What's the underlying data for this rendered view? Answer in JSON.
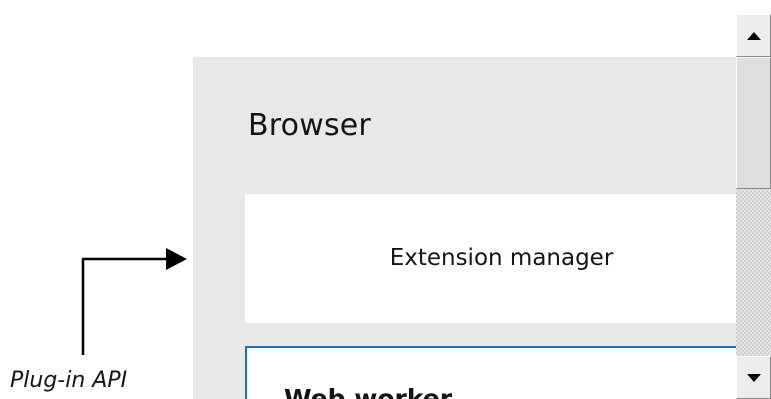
{
  "diagram": {
    "browser_title": "Browser",
    "extension_manager_label": "Extension manager",
    "web_worker_label": "Web worker",
    "plugin_api_label": "Plug-in API"
  },
  "colors": {
    "panel_background": "#e8e8e8",
    "box_background": "#ffffff",
    "worker_border": "#1e6fc0",
    "text": "#151515",
    "connector": "#000000"
  },
  "icons": {
    "scroll_up": "triangle-up-icon",
    "scroll_down": "triangle-down-icon",
    "connector_arrow": "arrow-right-icon"
  }
}
